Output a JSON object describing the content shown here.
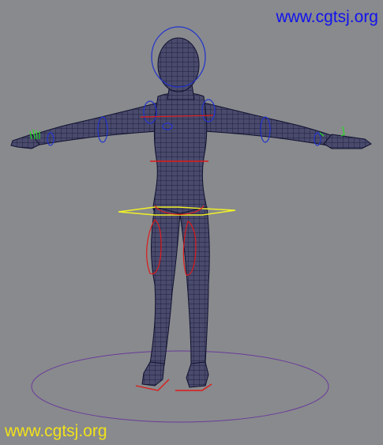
{
  "viewport": {
    "background": "#888a8d",
    "mesh_fill": "#4a4a6c",
    "mesh_wire": "#101030",
    "control_blue": "#2233cc",
    "control_red": "#dd1a1a",
    "control_yellow": "#f0f028",
    "control_green": "#22dd22",
    "ground_circle": "#6a3a9a"
  },
  "watermarks": {
    "top": "www.cgtsj.org",
    "top_color": "#1212ee",
    "bottom": "www.cgtsj.org",
    "bottom_color": "#f2e21a"
  },
  "rig": {
    "controls": [
      "head-ring-control",
      "shoulder-ring-left-control",
      "shoulder-ring-right-control",
      "elbow-ring-left-control",
      "elbow-ring-right-control",
      "chest-control",
      "waist-control",
      "hip-control",
      "thigh-left-control",
      "thigh-right-control",
      "foot-left-control",
      "foot-right-control",
      "hand-left-control",
      "hand-right-control",
      "ground-control"
    ]
  }
}
